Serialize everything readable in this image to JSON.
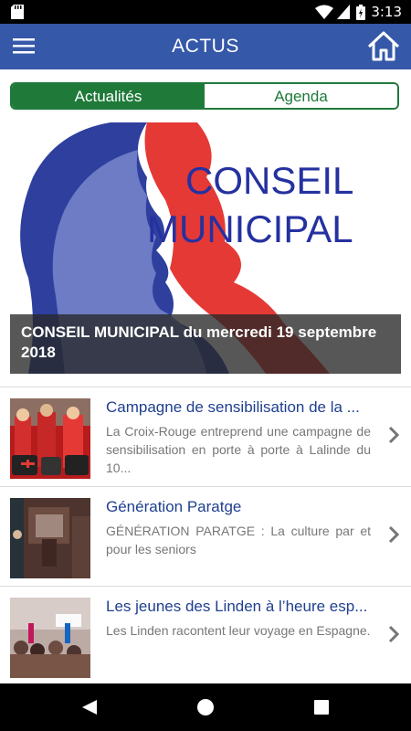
{
  "status_bar": {
    "time": "3:13"
  },
  "app_bar": {
    "title": "ACTUS"
  },
  "tabs": [
    {
      "label": "Actualités",
      "active": true
    },
    {
      "label": "Agenda",
      "active": false
    }
  ],
  "hero": {
    "image_text_line1": "CONSEIL",
    "image_text_line2": "MUNICIPAL",
    "caption": "CONSEIL MUNICIPAL du mercredi 19 septembre 2018"
  },
  "news": [
    {
      "title": "Campagne de sensibilisation de la ...",
      "description": "La Croix-Rouge entreprend une campagne de sensibilisation en porte à porte à Lalinde du 10..."
    },
    {
      "title": "Génération Paratge",
      "description": "GÉNÉRATION PARATGE : La culture par et pour les seniors"
    },
    {
      "title": "Les jeunes des Linden à l’heure esp...",
      "description": "Les Linden racontent leur voyage en Espagne."
    }
  ],
  "colors": {
    "app_bar": "#3558a8",
    "tab_active": "#1f7a3a",
    "item_title": "#1f3f8f"
  }
}
